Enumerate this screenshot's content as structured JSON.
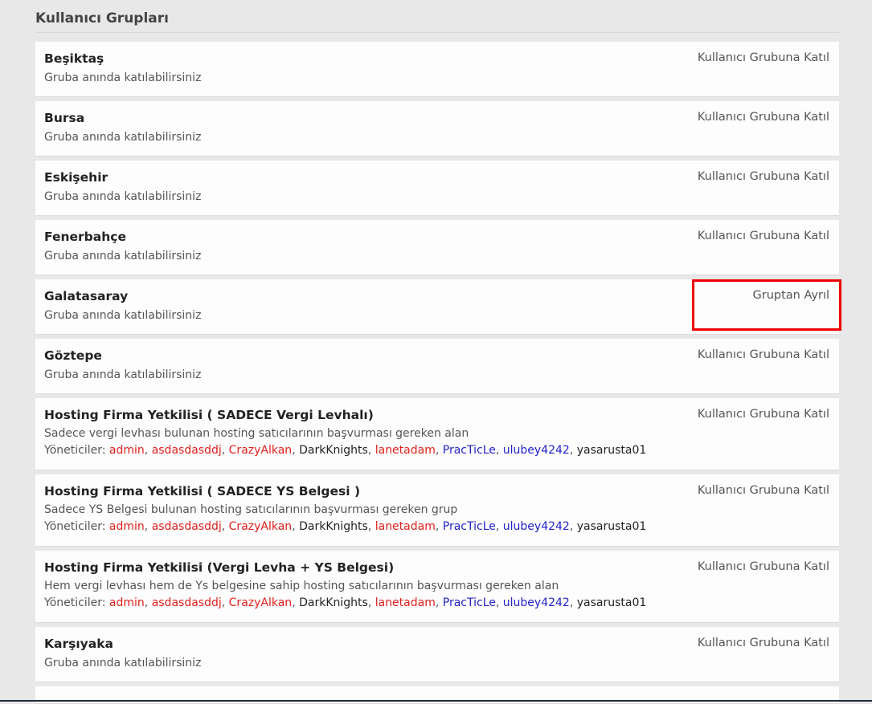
{
  "page": {
    "title": "Kullanıcı Grupları"
  },
  "groups": [
    {
      "name": "Beşiktaş",
      "desc": "Gruba anında katılabilirsiniz",
      "action": "Kullanıcı Grubuna Katıl"
    },
    {
      "name": "Bursa",
      "desc": "Gruba anında katılabilirsiniz",
      "action": "Kullanıcı Grubuna Katıl"
    },
    {
      "name": "Eskişehir",
      "desc": "Gruba anında katılabilirsiniz",
      "action": "Kullanıcı Grubuna Katıl"
    },
    {
      "name": "Fenerbahçe",
      "desc": "Gruba anında katılabilirsiniz",
      "action": "Kullanıcı Grubuna Katıl"
    },
    {
      "name": "Galatasaray",
      "desc": "Gruba anında katılabilirsiniz",
      "action": "Gruptan Ayrıl"
    },
    {
      "name": "Göztepe",
      "desc": "Gruba anında katılabilirsiniz",
      "action": "Kullanıcı Grubuna Katıl"
    },
    {
      "name": "Hosting Firma Yetkilisi ( SADECE Vergi Levhalı)",
      "desc": "Sadece vergi levhası bulunan hosting satıcılarının başvurması gereken alan",
      "managers_label": "Yöneticiler:",
      "action": "Kullanıcı Grubuna Katıl"
    },
    {
      "name": "Hosting Firma Yetkilisi ( SADECE YS Belgesi )",
      "desc": "Sadece YS Belgesi bulunan hosting satıcılarının başvurması gereken grup",
      "managers_label": "Yöneticiler:",
      "action": "Kullanıcı Grubuna Katıl"
    },
    {
      "name": "Hosting Firma Yetkilisi (Vergi Levha + YS Belgesi)",
      "desc": "Hem vergi levhası hem de Ys belgesine sahip hosting satıcılarının başvurması gereken alan",
      "managers_label": "Yöneticiler:",
      "action": "Kullanıcı Grubuna Katıl"
    },
    {
      "name": "Karşıyaka",
      "desc": "Gruba anında katılabilirsiniz",
      "action": "Kullanıcı Grubuna Katıl"
    }
  ],
  "managers": [
    {
      "name": "admin",
      "color": "#e0211d"
    },
    {
      "name": "asdasdasddj",
      "color": "#e0211d"
    },
    {
      "name": "CrazyAlkan",
      "color": "#e0211d"
    },
    {
      "name": "DarkKnights",
      "color": "#222222"
    },
    {
      "name": "lanetadam",
      "color": "#e0211d"
    },
    {
      "name": "PracTicLe",
      "color": "#2323c9"
    },
    {
      "name": "ulubey4242",
      "color": "#2323c9"
    },
    {
      "name": "yasarusta01",
      "color": "#222222"
    }
  ],
  "colors": {
    "background": "#e8e8e8",
    "card": "#fdfdfd",
    "highlight": "#ee0000"
  }
}
